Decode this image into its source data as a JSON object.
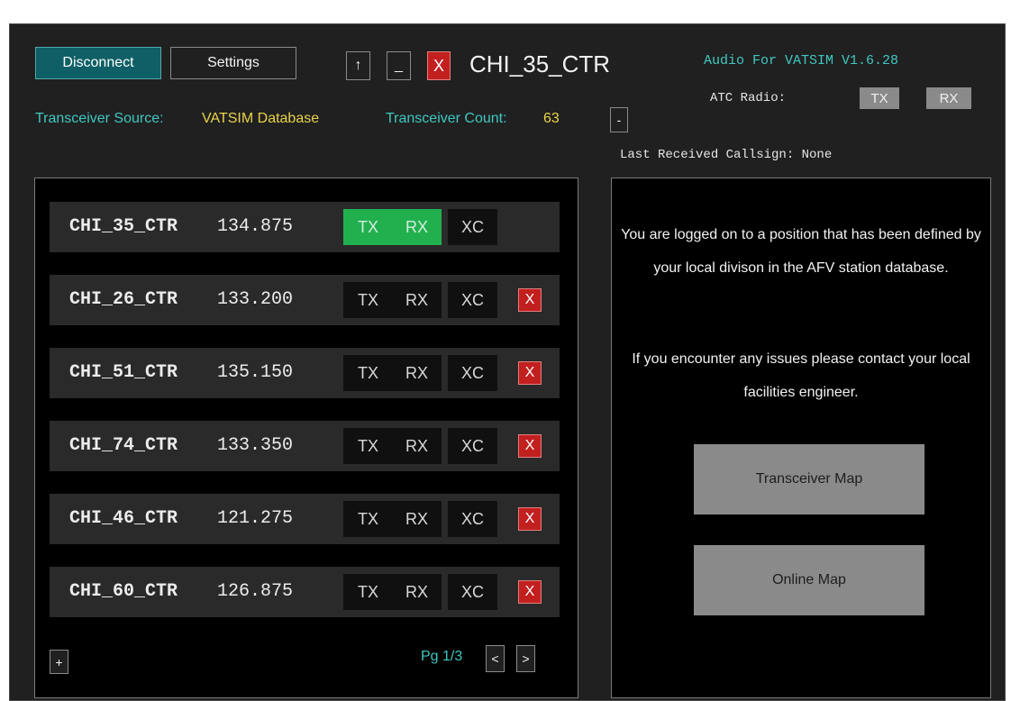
{
  "toolbar": {
    "disconnect_label": "Disconnect",
    "settings_label": "Settings",
    "up_label": "↑",
    "minimize_label": "_",
    "close_label": "X"
  },
  "title": {
    "callsign": "CHI_35_CTR",
    "app_version": "Audio For VATSIM V1.6.28"
  },
  "atc_radio": {
    "label": "ATC Radio:",
    "tx_label": "TX",
    "rx_label": "RX"
  },
  "transceiver": {
    "source_label": "Transceiver Source:",
    "source_value": "VATSIM Database",
    "count_label": "Transceiver Count:",
    "count_value": "63",
    "collapse_label": "-"
  },
  "last_received": "Last Received Callsign:  None",
  "stations": [
    {
      "callsign": "CHI_35_CTR",
      "frequency": "134.875",
      "tx": "TX",
      "rx": "RX",
      "xc": "XC",
      "tx_on": true,
      "rx_on": true,
      "removable": false
    },
    {
      "callsign": "CHI_26_CTR",
      "frequency": "133.200",
      "tx": "TX",
      "rx": "RX",
      "xc": "XC",
      "tx_on": false,
      "rx_on": false,
      "removable": true
    },
    {
      "callsign": "CHI_51_CTR",
      "frequency": "135.150",
      "tx": "TX",
      "rx": "RX",
      "xc": "XC",
      "tx_on": false,
      "rx_on": false,
      "removable": true
    },
    {
      "callsign": "CHI_74_CTR",
      "frequency": "133.350",
      "tx": "TX",
      "rx": "RX",
      "xc": "XC",
      "tx_on": false,
      "rx_on": false,
      "removable": true
    },
    {
      "callsign": "CHI_46_CTR",
      "frequency": "121.275",
      "tx": "TX",
      "rx": "RX",
      "xc": "XC",
      "tx_on": false,
      "rx_on": false,
      "removable": true
    },
    {
      "callsign": "CHI_60_CTR",
      "frequency": "126.875",
      "tx": "TX",
      "rx": "RX",
      "xc": "XC",
      "tx_on": false,
      "rx_on": false,
      "removable": true
    }
  ],
  "remove_label": "X",
  "pagination": {
    "add_label": "+",
    "page_label": "Pg 1/3",
    "prev_label": "<",
    "next_label": ">"
  },
  "info": {
    "message1": "You are logged on to a position that has been defined by your local divison in the AFV station database.",
    "message2": "If you encounter any issues please contact your local facilities engineer.",
    "transceiver_map_label": "Transceiver Map",
    "online_map_label": "Online Map"
  },
  "colors": {
    "accent_teal": "#3fc7c0",
    "value_yellow": "#e8d24a",
    "active_green": "#22b04f",
    "close_red": "#c21f1f",
    "disconnect_teal": "#0e5f66"
  }
}
